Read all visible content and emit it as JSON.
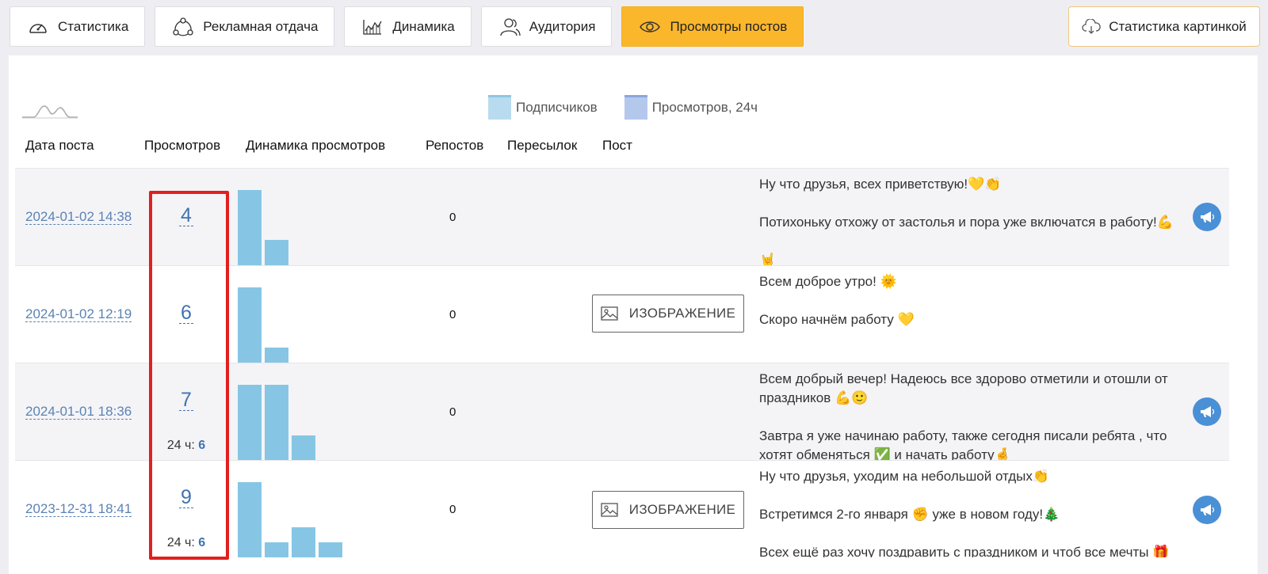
{
  "tabs": [
    {
      "label": "Статистика",
      "icon": "speedometer-icon",
      "active": false
    },
    {
      "label": "Рекламная отдача",
      "icon": "share-nodes-icon",
      "active": false
    },
    {
      "label": "Динамика",
      "icon": "line-chart-icon",
      "active": false
    },
    {
      "label": "Аудитория",
      "icon": "users-icon",
      "active": false
    },
    {
      "label": "Просмотры постов",
      "icon": "eye-icon",
      "active": true
    }
  ],
  "stat_image_button": {
    "label": "Статистика картинкой",
    "icon": "cloud-download-icon"
  },
  "legend": [
    {
      "label": "Подписчиков",
      "color": "#b9dbef"
    },
    {
      "label": "Просмотров, 24ч",
      "color": "#b4c8ec"
    }
  ],
  "columns": {
    "date": "Дата поста",
    "views": "Просмотров",
    "dynamics": "Динамика просмотров",
    "reposts": "Репостов",
    "forwards": "Пересылок",
    "post": "Пост"
  },
  "rows": [
    {
      "date": "2024-01-02 14:38",
      "views": "4",
      "views_24h": null,
      "bars": [
        4,
        1
      ],
      "reposts": "0",
      "image_button": null,
      "post_lines": [
        "Ну что друзья, всех приветствую!💛👏",
        "Потихоньку отхожу от застолья и пора уже включатся в работу!💪",
        "🤘"
      ],
      "megaphone": true
    },
    {
      "date": "2024-01-02 12:19",
      "views": "6",
      "views_24h": null,
      "bars": [
        4,
        1
      ],
      "reposts": "0",
      "image_button": "ИЗОБРАЖЕНИЕ",
      "post_lines": [
        "Всем доброе утро! 🌞",
        "Скоро начнём работу 💛"
      ],
      "megaphone": false
    },
    {
      "date": "2024-01-01 18:36",
      "views": "7",
      "views_24h": "6",
      "bars": [
        4,
        4,
        1.3
      ],
      "reposts": "0",
      "image_button": null,
      "post_lines": [
        "Всем добрый вечер! Надеюсь все здорово отметили и отошли от праздников 💪🙂",
        "Завтра я уже начинаю работу, также сегодня писали ребята , что хотят обменяться ✅ и начать работу🤞"
      ],
      "megaphone": true
    },
    {
      "date": "2023-12-31 18:41",
      "views": "9",
      "views_24h": "6",
      "bars": [
        4,
        1,
        2,
        1
      ],
      "reposts": "0",
      "image_button": "ИЗОБРАЖЕНИЕ",
      "post_lines": [
        "Ну что друзья, уходим на небольшой отдых👏",
        "Встретимся 2-го января ✊ уже в новом году!🎄",
        "Всех ещё раз хочу поздравить с праздником и чтоб все мечты 🎁"
      ],
      "megaphone": true
    }
  ],
  "labels": {
    "h24_prefix": "24 ч: "
  },
  "colors": {
    "accent": "#fbb72c",
    "link": "#3f73b0",
    "bar": "#86c6e4",
    "highlight": "#e0201f"
  }
}
